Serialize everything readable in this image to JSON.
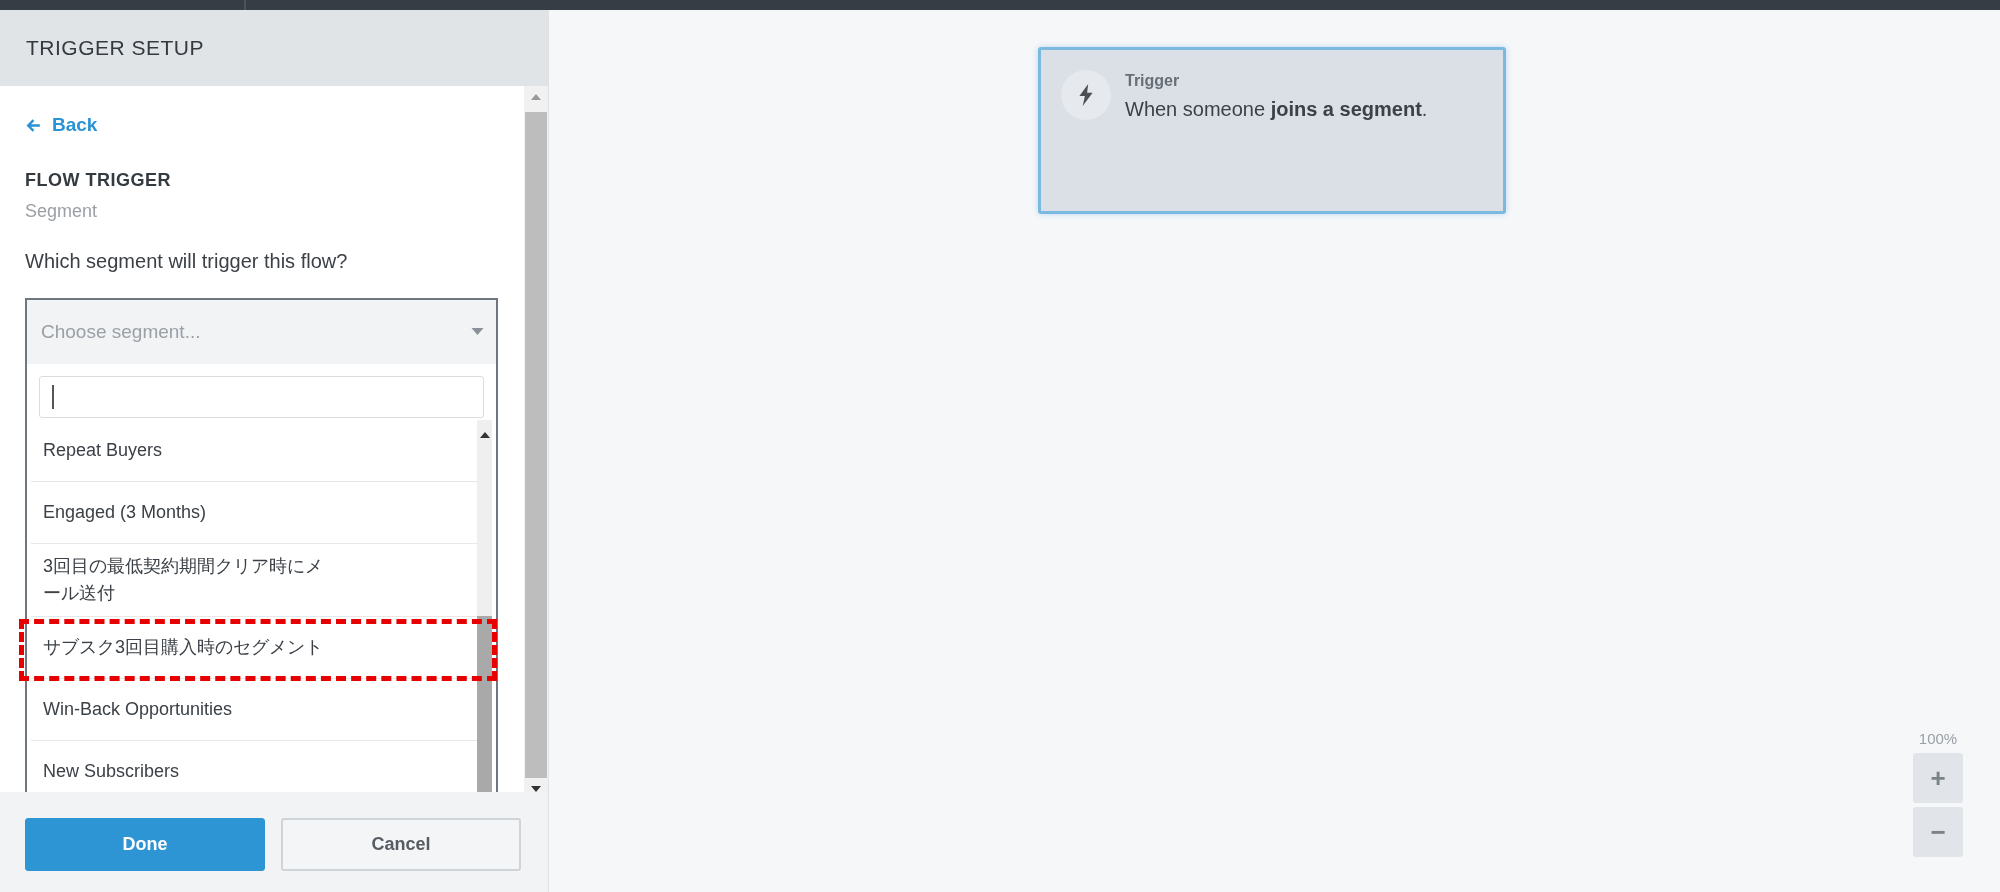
{
  "panel": {
    "title": "TRIGGER SETUP",
    "back_link": "Back",
    "section_title": "FLOW TRIGGER",
    "section_subtitle": "Segment",
    "question": "Which segment will trigger this flow?",
    "dropdown": {
      "placeholder": "Choose segment...",
      "expanded": true,
      "items": [
        {
          "label": "Repeat Buyers",
          "highlighted": false
        },
        {
          "label": "Engaged (3 Months)",
          "highlighted": false
        },
        {
          "label": "3回目の最低契約期間クリア時にメール送付",
          "highlighted": false
        },
        {
          "label": "サブスク3回目購入時のセグメント",
          "highlighted": true
        },
        {
          "label": "Win-Back Opportunities",
          "highlighted": false
        },
        {
          "label": "New Subscribers",
          "highlighted": false
        }
      ]
    },
    "buttons": [
      {
        "label": "Done",
        "kind": "primary"
      },
      {
        "label": "Cancel",
        "kind": "secondary"
      }
    ]
  },
  "canvas": {
    "trigger_card": {
      "title": "Trigger",
      "text": "When someone **joins a segment**."
    },
    "zoom": {
      "reading": "100%",
      "buttons": [
        "+",
        "−"
      ]
    }
  }
}
